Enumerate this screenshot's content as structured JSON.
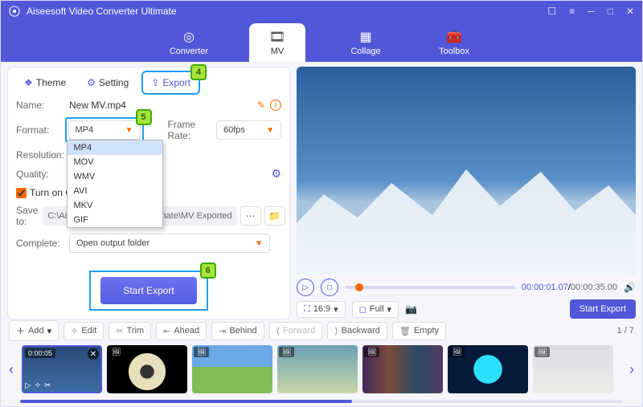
{
  "app": {
    "title": "Aiseesoft Video Converter Ultimate"
  },
  "tabs": {
    "converter": "Converter",
    "mv": "MV",
    "collage": "Collage",
    "toolbox": "Toolbox"
  },
  "subtabs": {
    "theme": "Theme",
    "setting": "Setting",
    "export": "Export"
  },
  "callouts": {
    "export": "4",
    "format": "5",
    "start": "6"
  },
  "form": {
    "name_label": "Name:",
    "name_value": "New MV.mp4",
    "format_label": "Format:",
    "format_value": "MP4",
    "format_options": [
      "MP4",
      "MOV",
      "WMV",
      "AVI",
      "MKV",
      "GIF"
    ],
    "framerate_label": "Frame Rate:",
    "framerate_value": "60fps",
    "resolution_label": "Resolution:",
    "quality_label": "Quality:",
    "turn_on_label": "Turn on G",
    "saveto_label": "Save to:",
    "saveto_value": "C:\\Aiseesoft Studio\\Ai...r Ultimate\\MV Exported",
    "complete_label": "Complete:",
    "complete_value": "Open output folder",
    "start_export": "Start Export"
  },
  "player": {
    "time_current": "00:00:01.07",
    "time_total": "00:00:35.00",
    "aspect": "16:9",
    "zoom": "Full",
    "start_export_right": "Start Export"
  },
  "toolbar": {
    "add": "Add",
    "edit": "Edit",
    "trim": "Trim",
    "ahead": "Ahead",
    "behind": "Behind",
    "forward": "Forward",
    "backward": "Backward",
    "empty": "Empty",
    "page_current": "1",
    "page_total": "7"
  },
  "thumbs": {
    "first_duration": "0:00:05"
  }
}
